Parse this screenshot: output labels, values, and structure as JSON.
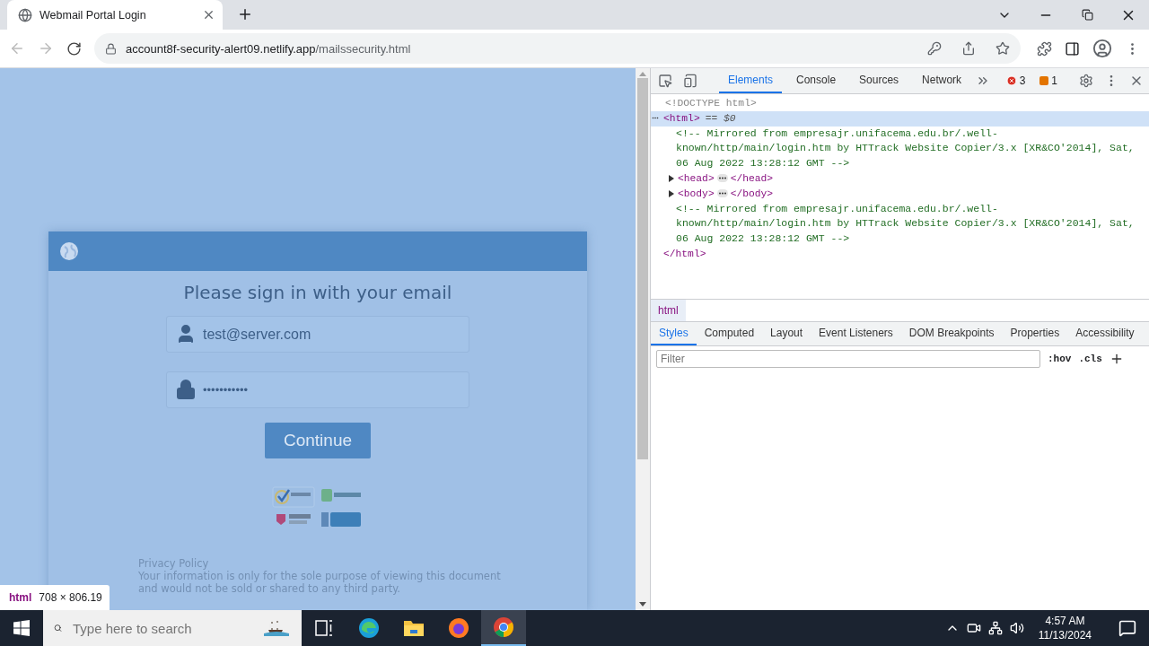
{
  "browser": {
    "tab_title": "Webmail Portal Login",
    "url_host": "account8f-security-alert09.netlify.app",
    "url_path": "/mailssecurity.html"
  },
  "page": {
    "heading": "Please sign in with your email",
    "email_value": "test@server.com",
    "password_value": "•••••••••••",
    "button": "Continue",
    "privacy_title": "Privacy Policy",
    "privacy_lines": [
      "Your information is only for the sole purpose of viewing this document",
      "and would not be sold or shared to any third party."
    ]
  },
  "inspect_badge": {
    "tag": "html",
    "size": "708 × 806.19"
  },
  "devtools": {
    "tabs": [
      {
        "label": "Elements",
        "selected": true
      },
      {
        "label": "Console",
        "selected": false
      },
      {
        "label": "Sources",
        "selected": false
      },
      {
        "label": "Network",
        "selected": false
      }
    ],
    "errors": "3",
    "warnings": "1",
    "dom": [
      {
        "kind": "doctype",
        "text": "<!DOCTYPE html>"
      },
      {
        "kind": "element",
        "tag": "<html>",
        "marker": "== $0",
        "selected": true,
        "expanded": true,
        "close": "</html>",
        "children": [
          {
            "kind": "comment",
            "text": "<!-- Mirrored from empresajr.unifacema.edu.br/.well-known/http/main/login.htm by HTTrack Website Copier/3.x [XR&CO'2014], Sat, 06 Aug 2022 13:28:12 GMT -->"
          },
          {
            "kind": "element",
            "tag": "<head>",
            "close": "</head>",
            "selected": false,
            "expanded": false
          },
          {
            "kind": "element",
            "tag": "<body>",
            "close": "</body>",
            "selected": false,
            "expanded": false
          },
          {
            "kind": "comment",
            "text": "<!-- Mirrored from empresajr.unifacema.edu.br/.well-known/http/main/login.htm by HTTrack Website Copier/3.x [XR&CO'2014], Sat, 06 Aug 2022 13:28:12 GMT -->"
          }
        ]
      }
    ],
    "breadcrumb": "html",
    "style_tabs": [
      {
        "label": "Styles",
        "selected": true
      },
      {
        "label": "Computed",
        "selected": false
      },
      {
        "label": "Layout",
        "selected": false
      },
      {
        "label": "Event Listeners",
        "selected": false
      },
      {
        "label": "DOM Breakpoints",
        "selected": false
      },
      {
        "label": "Properties",
        "selected": false
      },
      {
        "label": "Accessibility",
        "selected": false
      }
    ],
    "filter_placeholder": "Filter",
    "hov": ":hov",
    "cls": ".cls"
  },
  "taskbar": {
    "search_placeholder": "Type here to search",
    "time": "4:57 AM",
    "date": "11/13/2024"
  }
}
